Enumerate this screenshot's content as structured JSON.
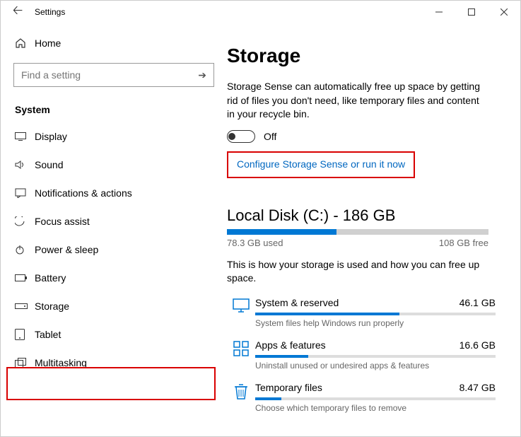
{
  "window": {
    "title": "Settings"
  },
  "sidebar": {
    "home": "Home",
    "search_placeholder": "Find a setting",
    "section": "System",
    "items": [
      {
        "label": "Display"
      },
      {
        "label": "Sound"
      },
      {
        "label": "Notifications & actions"
      },
      {
        "label": "Focus assist"
      },
      {
        "label": "Power & sleep"
      },
      {
        "label": "Battery"
      },
      {
        "label": "Storage"
      },
      {
        "label": "Tablet"
      },
      {
        "label": "Multitasking"
      }
    ]
  },
  "content": {
    "heading": "Storage",
    "sense_desc": "Storage Sense can automatically free up space by getting rid of files you don't need, like temporary files and content in your recycle bin.",
    "toggle_state": "Off",
    "configure_link": "Configure Storage Sense or run it now",
    "disk": {
      "title": "Local Disk (C:) - 186 GB",
      "used_label": "78.3 GB used",
      "free_label": "108 GB free",
      "fill_percent": 42
    },
    "usage_desc": "This is how your storage is used and how you can free up space.",
    "categories": [
      {
        "name": "System & reserved",
        "size": "46.1 GB",
        "sub": "System files help Windows run properly",
        "fill": 60
      },
      {
        "name": "Apps & features",
        "size": "16.6 GB",
        "sub": "Uninstall unused or undesired apps & features",
        "fill": 22
      },
      {
        "name": "Temporary files",
        "size": "8.47 GB",
        "sub": "Choose which temporary files to remove",
        "fill": 11
      }
    ]
  }
}
